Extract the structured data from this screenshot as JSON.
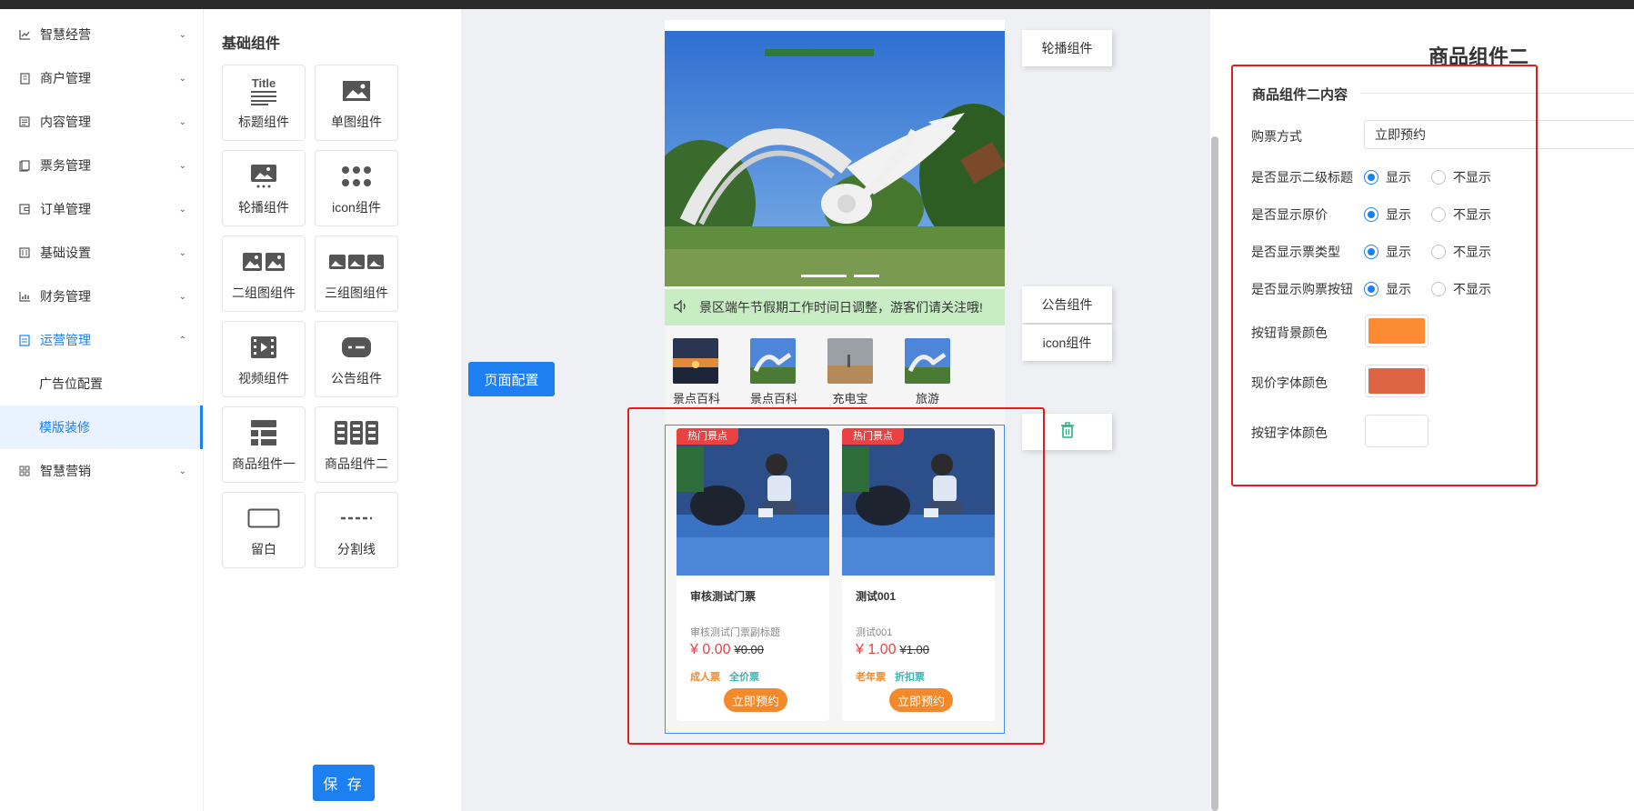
{
  "sidebar": {
    "items": [
      {
        "label": "智慧经营",
        "icon": "line-chart-icon"
      },
      {
        "label": "商户管理",
        "icon": "building-icon"
      },
      {
        "label": "内容管理",
        "icon": "document-icon"
      },
      {
        "label": "票务管理",
        "icon": "ticket-icon"
      },
      {
        "label": "订单管理",
        "icon": "wallet-icon"
      },
      {
        "label": "基础设置",
        "icon": "settings-chart-icon"
      },
      {
        "label": "财务管理",
        "icon": "bar-chart-icon"
      },
      {
        "label": "运营管理",
        "icon": "operations-icon"
      },
      {
        "label": "智慧营销",
        "icon": "grid-icon"
      }
    ],
    "sub_items": [
      {
        "label": "广告位配置"
      },
      {
        "label": "模版装修"
      }
    ]
  },
  "components": {
    "title": "基础组件",
    "items": [
      {
        "label": "标题组件",
        "icon": "title-icon",
        "icon_text": "Title"
      },
      {
        "label": "单图组件",
        "icon": "image-icon"
      },
      {
        "label": "轮播组件",
        "icon": "carousel-icon"
      },
      {
        "label": "icon组件",
        "icon": "dots-icon"
      },
      {
        "label": "二组图组件",
        "icon": "two-images-icon"
      },
      {
        "label": "三组图组件",
        "icon": "three-images-icon"
      },
      {
        "label": "视频组件",
        "icon": "video-icon"
      },
      {
        "label": "公告组件",
        "icon": "notice-icon"
      },
      {
        "label": "商品组件一",
        "icon": "goods-list-icon"
      },
      {
        "label": "商品组件二",
        "icon": "goods-grid-icon"
      },
      {
        "label": "留白",
        "icon": "blank-icon"
      },
      {
        "label": "分割线",
        "icon": "divider-icon"
      }
    ],
    "save_label": "保 存"
  },
  "canvas": {
    "page_config_label": "页面配置",
    "notice_text": "景区端午节假期工作时间日调整，游客们请关注哦!",
    "icon_items": [
      {
        "label": "景点百科"
      },
      {
        "label": "景点百科"
      },
      {
        "label": "充电宝"
      },
      {
        "label": "旅游"
      }
    ],
    "goods": [
      {
        "tag": "热门景点",
        "name": "审核测试门票",
        "subtitle": "审核测试门票副标题",
        "price": "¥ 0.00",
        "original_price": "¥0.00",
        "tag1": "成人票",
        "tag2": "全价票",
        "button": "立即预约"
      },
      {
        "tag": "热门景点",
        "name": "测试001",
        "subtitle": "测试001",
        "price": "¥ 1.00",
        "original_price": "¥1.00",
        "tag1": "老年票",
        "tag2": "折扣票",
        "button": "立即预约"
      }
    ],
    "side_tabs": {
      "carousel": "轮播组件",
      "notice": "公告组件",
      "icon": "icon组件"
    }
  },
  "config": {
    "title": "商品组件二",
    "section_title": "商品组件二内容",
    "purchase_label": "购票方式",
    "purchase_value": "立即预约",
    "radio_rows": [
      {
        "label": "是否显示二级标题",
        "on": "显示",
        "off": "不显示",
        "selected": "on"
      },
      {
        "label": "是否显示原价",
        "on": "显示",
        "off": "不显示",
        "selected": "on"
      },
      {
        "label": "是否显示票类型",
        "on": "显示",
        "off": "不显示",
        "selected": "on"
      },
      {
        "label": "是否显示购票按钮",
        "on": "显示",
        "off": "不显示",
        "selected": "on"
      }
    ],
    "colors": [
      {
        "label": "按钮背景颜色",
        "value": "#fb8a32"
      },
      {
        "label": "现价字体颜色",
        "value": "#df6443"
      },
      {
        "label": "按钮字体颜色",
        "value": "#ffffff"
      }
    ]
  }
}
